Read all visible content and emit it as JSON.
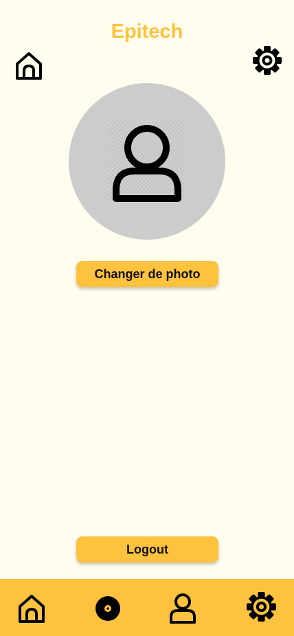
{
  "header": {
    "title": "Epitech"
  },
  "profile": {
    "change_photo_label": "Changer de photo"
  },
  "actions": {
    "logout_label": "Logout"
  },
  "nav": {
    "items": [
      {
        "icon": "home-icon"
      },
      {
        "icon": "music-disc-icon"
      },
      {
        "icon": "user-icon"
      },
      {
        "icon": "gear-icon"
      }
    ]
  },
  "colors": {
    "background": "#FFFDEE",
    "accent": "#FEC23E",
    "avatar_bg": "#CCCCCC",
    "icon": "#000000"
  }
}
